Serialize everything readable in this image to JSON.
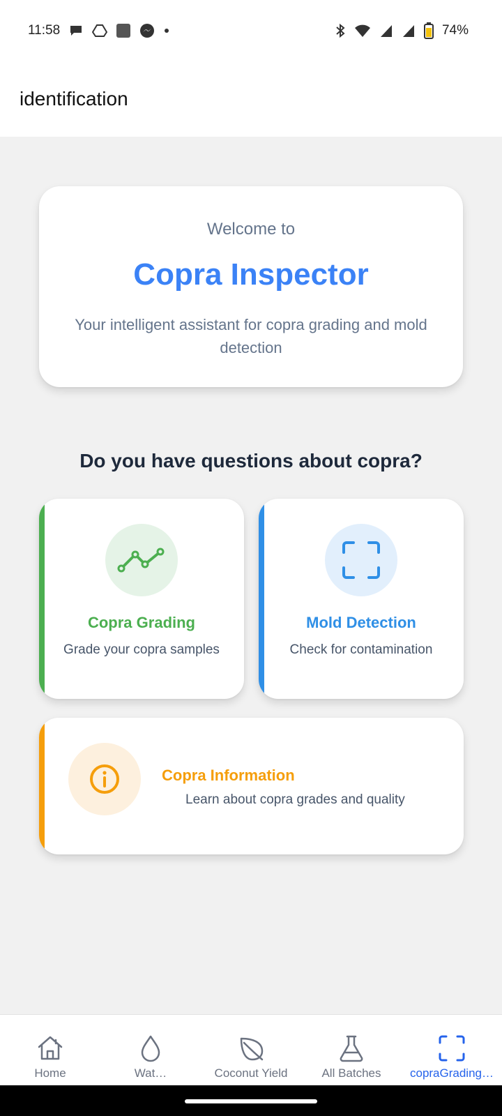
{
  "status_bar": {
    "time": "11:58",
    "battery": "74%",
    "left_icons": [
      "chat-bubble-icon",
      "drive-icon",
      "app-square-icon",
      "messenger-icon",
      "dot-icon"
    ],
    "right_icons": [
      "bluetooth-icon",
      "wifi-icon",
      "signal-icon",
      "signal-icon",
      "battery-icon"
    ]
  },
  "header": {
    "title": "identification"
  },
  "welcome": {
    "pre_title": "Welcome to",
    "title": "Copra Inspector",
    "description": "Your intelligent assistant for copra grading and mold detection"
  },
  "question": "Do you have questions about copra?",
  "cards": {
    "grading": {
      "title": "Copra Grading",
      "subtitle": "Grade your copra samples",
      "color": "#4caf50",
      "icon": "trend-line-icon"
    },
    "mold": {
      "title": "Mold Detection",
      "subtitle": "Check for contamination",
      "color": "#2f8fe6",
      "icon": "scan-frame-icon"
    },
    "info": {
      "title": "Copra Information",
      "subtitle": "Learn about copra grades and quality",
      "color": "#f59e0b",
      "icon": "info-icon"
    }
  },
  "bottom_nav": {
    "items": [
      {
        "label": "Home",
        "icon": "home-icon",
        "active": false
      },
      {
        "label": "Wat…",
        "icon": "water-drop-icon",
        "active": false
      },
      {
        "label": "Coconut Yield",
        "icon": "leaf-icon",
        "active": false
      },
      {
        "label": "All Batches",
        "icon": "flask-icon",
        "active": false
      },
      {
        "label": "copraGrading…",
        "icon": "scan-frame-icon",
        "active": true
      }
    ]
  }
}
